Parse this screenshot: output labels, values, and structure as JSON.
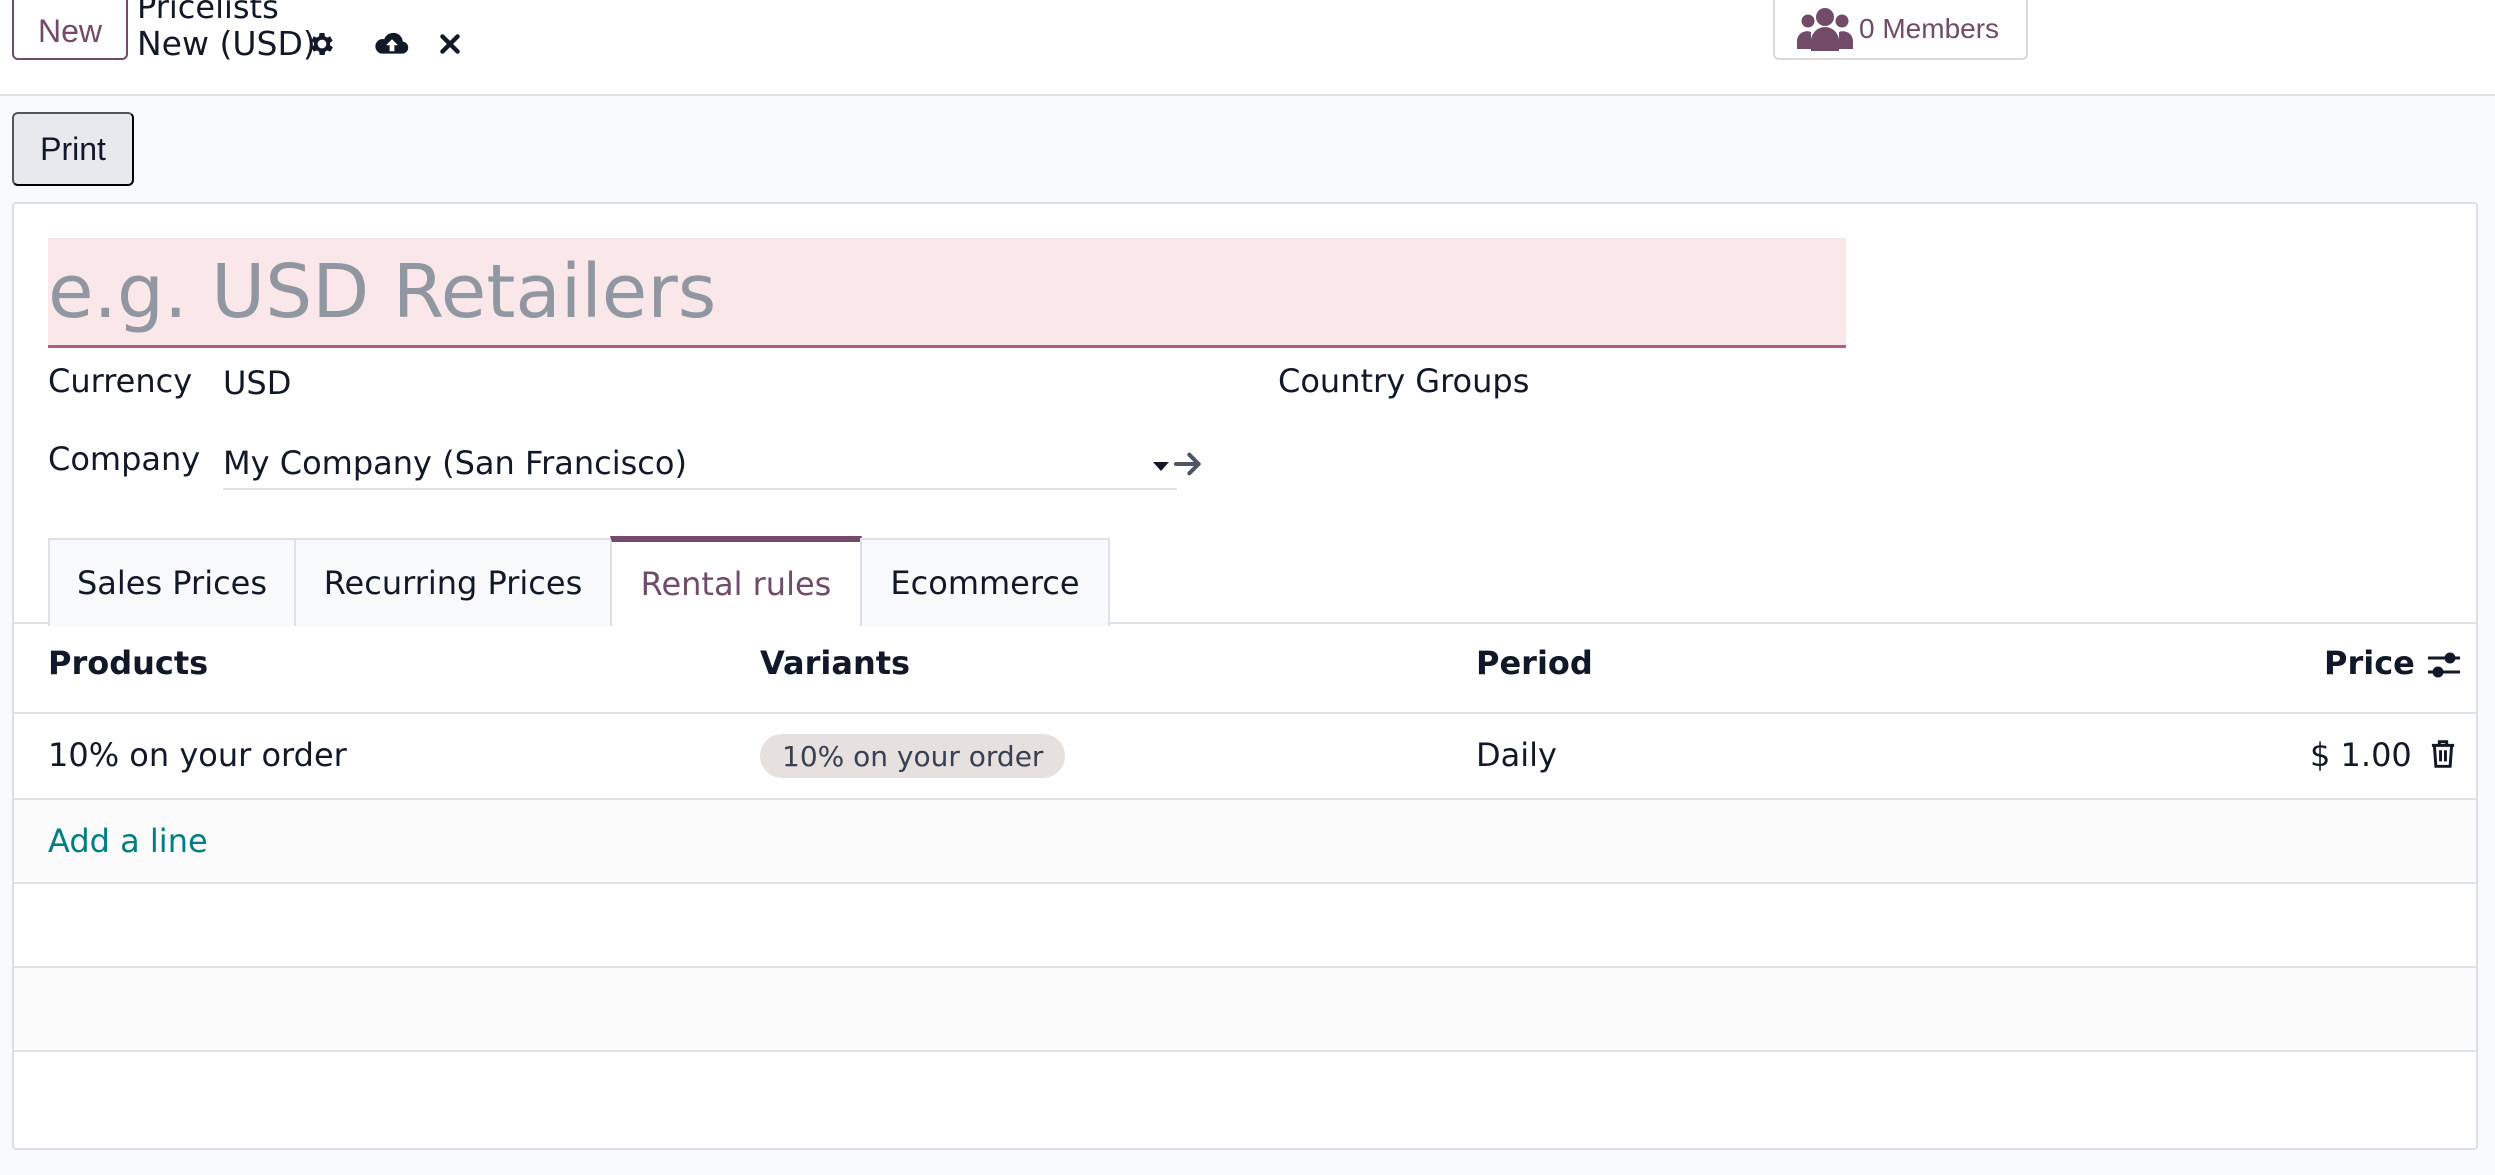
{
  "control_panel": {
    "new_button": "New",
    "breadcrumb_parent": "Pricelists",
    "breadcrumb_current": "New (USD)",
    "members_button": "0 Members"
  },
  "actions": {
    "print_button": "Print"
  },
  "form": {
    "name_placeholder": "e.g. USD Retailers",
    "currency_label": "Currency",
    "currency_value": "USD",
    "company_label": "Company",
    "company_value": "My Company (San Francisco)",
    "country_groups_label": "Country Groups"
  },
  "tabs": [
    {
      "label": "Sales Prices"
    },
    {
      "label": "Recurring Prices"
    },
    {
      "label": "Rental rules",
      "active": true
    },
    {
      "label": "Ecommerce"
    }
  ],
  "table": {
    "columns": [
      "Products",
      "Variants",
      "Period",
      "Price"
    ],
    "rows": [
      {
        "product": "10% on your order",
        "variant": "10% on your order",
        "period": "Daily",
        "price": "$ 1.00"
      }
    ],
    "add_line": "Add a line"
  },
  "colors": {
    "brand": "#714b67",
    "link": "#017e84",
    "required_bg": "#f9e7e9"
  },
  "icons": [
    "gear-icon",
    "cloud-upload-icon",
    "close-icon",
    "users-icon",
    "arrow-right-icon",
    "sliders-icon",
    "trash-icon",
    "caret-down-icon"
  ]
}
